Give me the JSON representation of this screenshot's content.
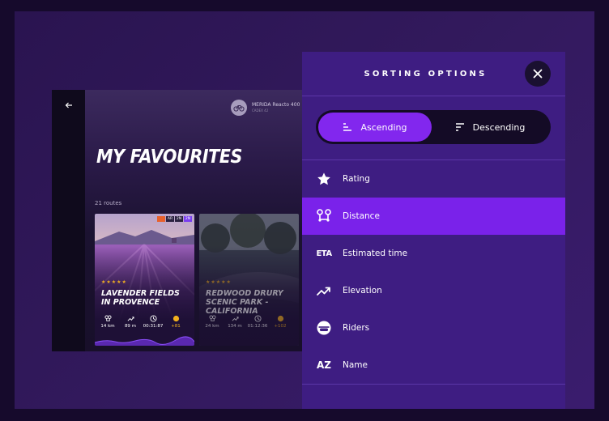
{
  "app": {
    "bike": {
      "name": "MERIDA Reacto 400",
      "sub": "CADEX 42"
    },
    "page_title": "MY FAVOURITES",
    "route_count": "21 routes",
    "cards": [
      {
        "tags": [
          "",
          "AR",
          "2N",
          "2N"
        ],
        "stars": "★★★★★",
        "title": "LAVENDER FIELDS IN PROVENCE",
        "stats": {
          "distance": "14 km",
          "elevation": "89 m",
          "time": "00:31:87",
          "points": "+81"
        }
      },
      {
        "stars": "★★★★★",
        "title": "REDWOOD DRURY SCENIC PARK - CALIFORNIA",
        "stats": {
          "distance": "24 km",
          "elevation": "134 m",
          "time": "01:12:36",
          "points": "+102"
        }
      }
    ]
  },
  "panel": {
    "title": "SORTING OPTIONS",
    "order": {
      "ascending": "Ascending",
      "descending": "Descending",
      "selected": "Ascending"
    },
    "options": [
      {
        "label": "Rating",
        "icon": "star-icon"
      },
      {
        "label": "Distance",
        "icon": "route-pins-icon",
        "active": true
      },
      {
        "label": "Estimated time",
        "icon": "eta-icon",
        "text": "ETA"
      },
      {
        "label": "Elevation",
        "icon": "trend-up-icon"
      },
      {
        "label": "Riders",
        "icon": "rider-helmet-icon"
      },
      {
        "label": "Name",
        "icon": "az-icon",
        "text": "AZ"
      }
    ]
  },
  "colors": {
    "accent": "#7a22ea",
    "panel": "#3e1d82",
    "star": "#f2b01e"
  }
}
